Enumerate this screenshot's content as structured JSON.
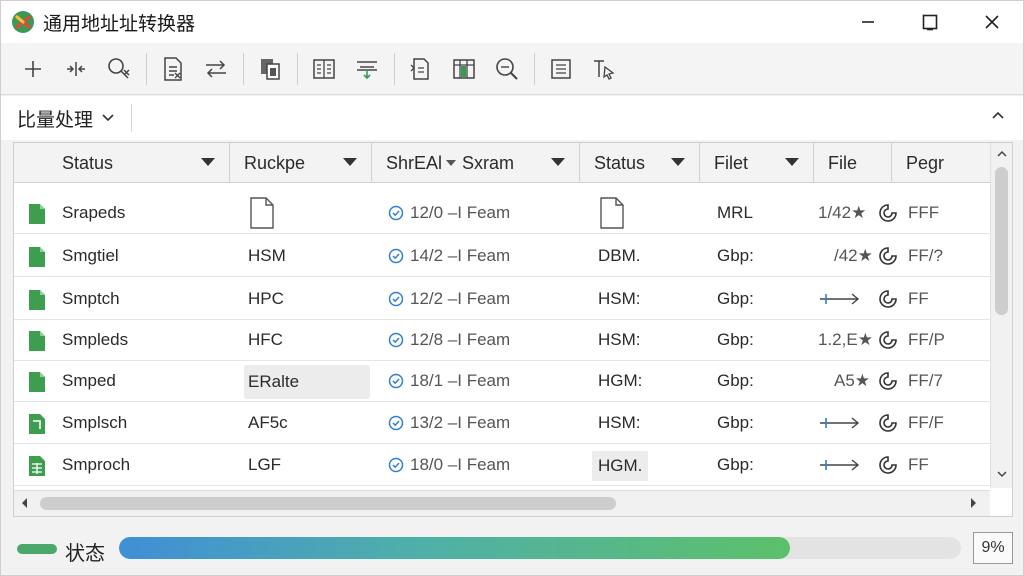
{
  "window": {
    "title": "通用地址址转换器"
  },
  "toolbar": {
    "buttons": [
      "add-icon",
      "split-icon",
      "search-replace-icon",
      "document-list-icon",
      "swap-icon",
      "copy-icon",
      "columns-icon",
      "align-icon",
      "document-icon",
      "table-icon",
      "zoom-icon",
      "list-icon",
      "select-icon"
    ]
  },
  "subbar": {
    "label": "比量处理"
  },
  "grid": {
    "columns": [
      "Status",
      "Ruckpe",
      "ShrEAl",
      "Sxram",
      "Status",
      "Filet",
      "File",
      "Pegr"
    ],
    "rows": [
      {
        "name": "Srapeds",
        "type": "",
        "date": "12/0 –I Feam",
        "status": "",
        "file": "MRL",
        "size": "1/42★",
        "flag": "FFF"
      },
      {
        "name": "Smgtiel",
        "type": "HSM",
        "date": "14/2 –I Feam",
        "status": "DBM.",
        "file": "Gbp:",
        "size": "/42★",
        "flag": "FF/?"
      },
      {
        "name": "Smptch",
        "type": "HPC",
        "date": "12/2 –I Feam",
        "status": "HSM:",
        "file": "Gbp:",
        "size": "",
        "flag": "FF"
      },
      {
        "name": "Smpleds",
        "type": "HFC",
        "date": "12/8 –I Feam",
        "status": "HSM:",
        "file": "Gbp:",
        "size": "1.2,E★",
        "flag": "FF/P"
      },
      {
        "name": "Smped",
        "type": "ERalte",
        "date": "18/1 –I Feam",
        "status": "HGM:",
        "file": "Gbp:",
        "size": "A5★",
        "flag": "FF/7"
      },
      {
        "name": "Smplsch",
        "type": "AF5c",
        "date": "13/2 –I Feam",
        "status": "HSM:",
        "file": "Gbp:",
        "size": "",
        "flag": "FF/F"
      },
      {
        "name": "Smproch",
        "type": "LGF",
        "date": "18/0 –I Feam",
        "status": "HGM.",
        "file": "Gbp:",
        "size": "",
        "flag": "FF"
      }
    ]
  },
  "statusbar": {
    "label": "状态",
    "progress": 0.797,
    "percent_text": "9%"
  },
  "colors": {
    "accent_green": "#4aa86a",
    "progress_start": "#3f8fd6",
    "progress_end": "#5cc06a",
    "check_blue": "#2f7fd0"
  }
}
